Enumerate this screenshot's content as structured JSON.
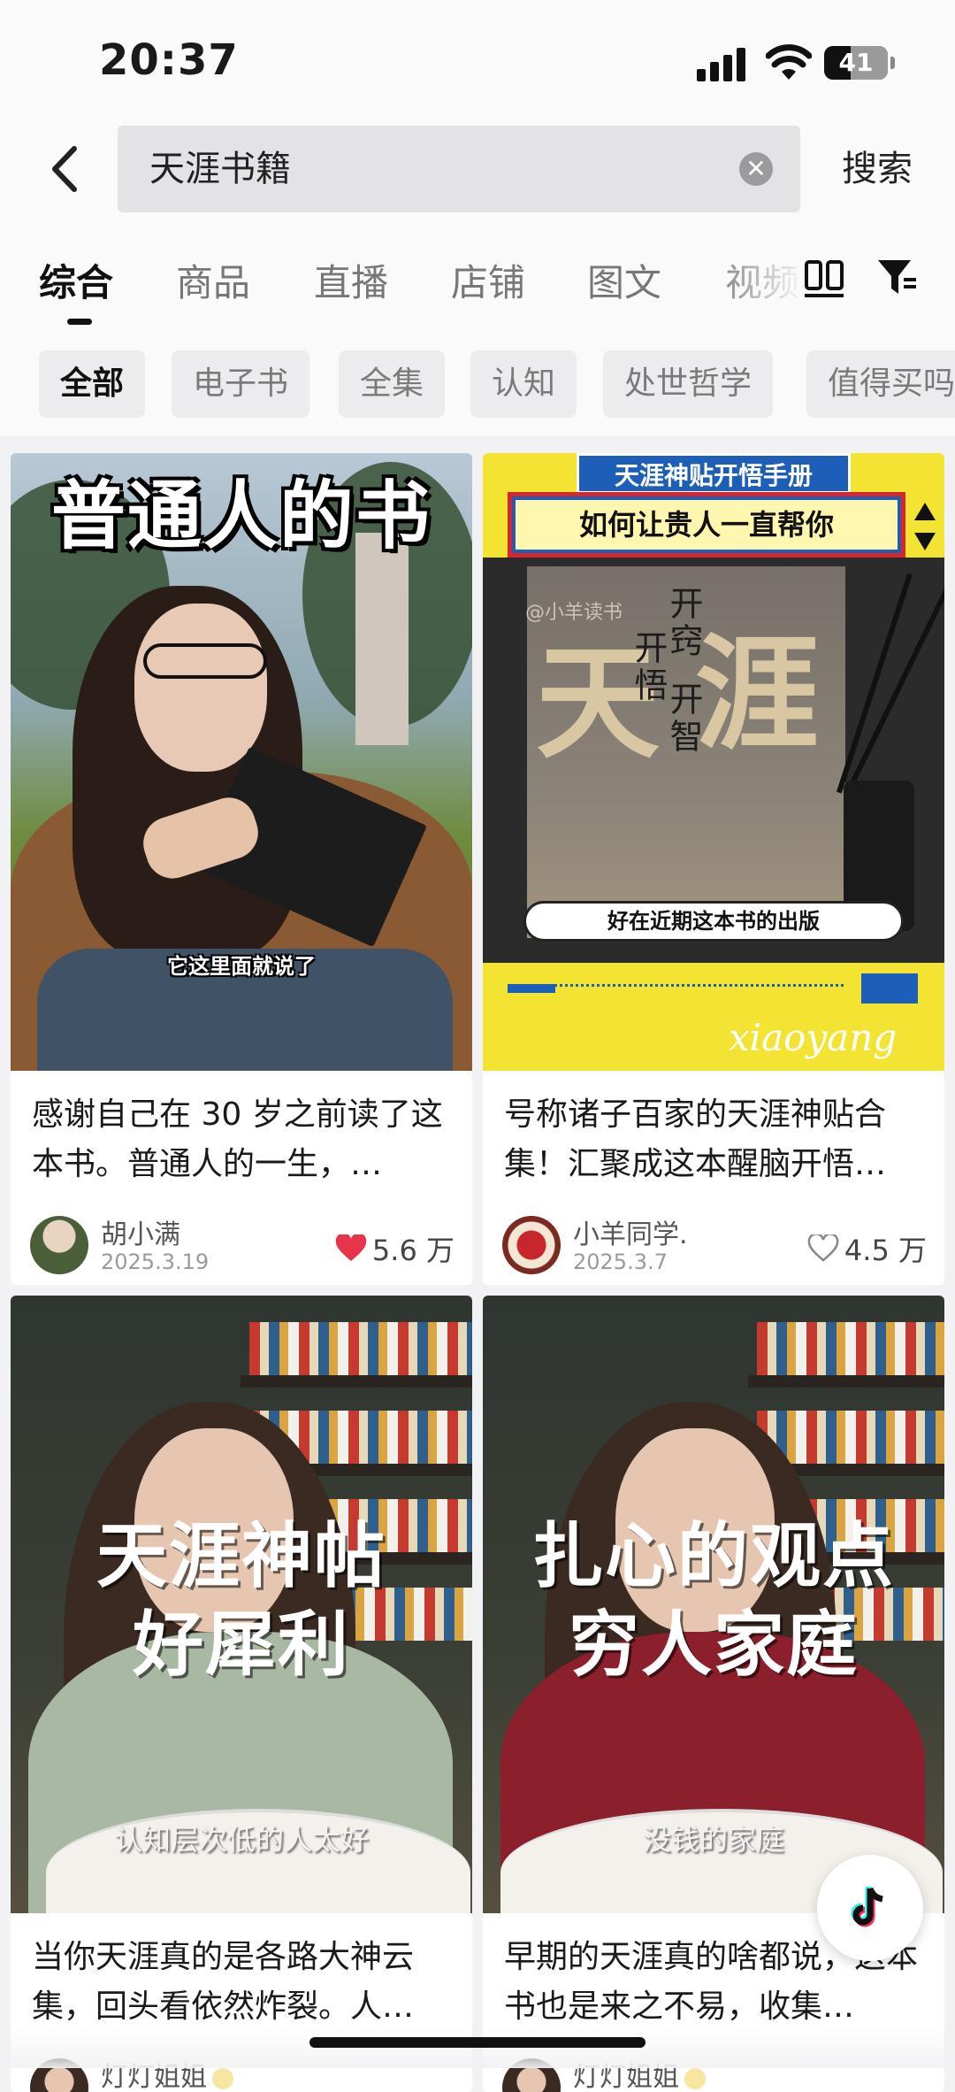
{
  "status_bar": {
    "time": "20:37",
    "battery": "41"
  },
  "search": {
    "query": "天涯书籍",
    "submit_label": "搜索"
  },
  "tabs": [
    {
      "label": "综合",
      "active": true
    },
    {
      "label": "商品"
    },
    {
      "label": "直播"
    },
    {
      "label": "店铺"
    },
    {
      "label": "图文"
    },
    {
      "label": "视频"
    }
  ],
  "chips": [
    {
      "label": "全部",
      "active": true
    },
    {
      "label": "电子书"
    },
    {
      "label": "全集"
    },
    {
      "label": "认知"
    },
    {
      "label": "处世哲学"
    },
    {
      "label": "值得买吗"
    }
  ],
  "results": [
    {
      "overlay_title": "普通人的书",
      "overlay_caption": "它这里面就说了",
      "title": "感谢自己在 30 岁之前读了这本书。普通人的一生，…",
      "author": "胡小满",
      "date": "2025.3.19",
      "likes": "5.6 万",
      "liked": true
    },
    {
      "ribbon": "天涯神贴开悟手册",
      "banner": "如何让贵人一直帮你",
      "cover_big_1": "天",
      "cover_big_2": "涯",
      "cover_vertical_1": "开窍",
      "cover_vertical_2": "开悟",
      "cover_vertical_3": "开智",
      "cover_watermark": "@小羊读书",
      "pill": "好在近期这本书的出版",
      "watermark": "xiaoyang",
      "title": "号称诸子百家的天涯神贴合集！汇聚成这本醒脑开悟…",
      "author": "小羊同学.",
      "date": "2025.3.7",
      "likes": "4.5 万",
      "liked": false
    },
    {
      "overlay_line1": "天涯神帖",
      "overlay_line2": "好犀利",
      "caption": "认知层次低的人太好",
      "title": "当你天涯真的是各路大神云集，回头看依然炸裂。人…",
      "author": "灯灯姐姐"
    },
    {
      "overlay_line1": "扎心的观点",
      "overlay_line2": "穷人家庭",
      "caption": "没钱的家庭",
      "title": "早期的天涯真的啥都说，这本书也是来之不易，收集…",
      "author": "灯灯姐姐"
    }
  ],
  "colors": {
    "like_red": "#e8344a",
    "accent_blue": "#1d5fb8",
    "cover_yellow": "#f3e434"
  },
  "icons": [
    "back-chevron-icon",
    "clear-icon",
    "layout-toggle-icon",
    "filter-icon",
    "heart-filled-icon",
    "heart-outline-icon",
    "douyin-logo-icon"
  ]
}
